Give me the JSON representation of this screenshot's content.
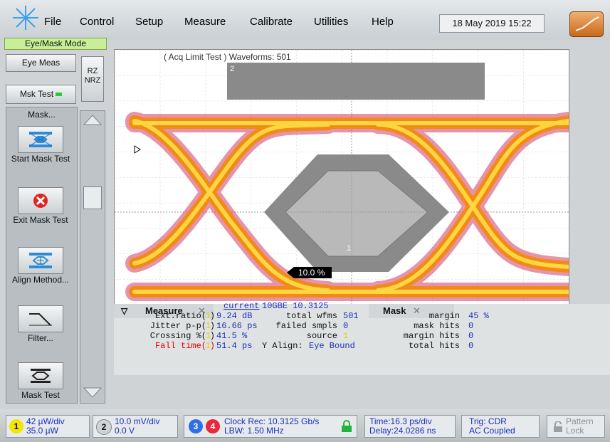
{
  "menu": {
    "file": "File",
    "control": "Control",
    "setup": "Setup",
    "measure": "Measure",
    "calibrate": "Calibrate",
    "utilities": "Utilities",
    "help": "Help"
  },
  "datetime": "18 May 2019   15:22",
  "mode_tab": "Eye/Mask Mode",
  "left": {
    "eye_meas": "Eye Meas",
    "msk_test": "Msk Test",
    "rz": "RZ",
    "nrz": "NRZ",
    "strip_title": "Mask...",
    "tools": [
      "Start Mask Test",
      "Exit Mask Test",
      "Align Method...",
      "Filter...",
      "Mask Test"
    ]
  },
  "screen": {
    "title": "( Acq Limit Test )  Waveforms: 501",
    "marker_2": "2",
    "marker_1": "1",
    "margin_label": "10.0 %"
  },
  "measure_tab": "Measure",
  "mask_tab": "Mask",
  "measure": {
    "current_header": "current",
    "rows": [
      {
        "label": "Ext.ratio(",
        "ch": "1",
        "value": "9.24 dB"
      },
      {
        "label": "Jitter p-p(",
        "ch": "1",
        "value": "16.66 ps"
      },
      {
        "label": "Crossing %(",
        "ch": "1",
        "value": "41.5 %"
      },
      {
        "label": "Fall time(",
        "ch": "1",
        "value": "51.4 ps"
      }
    ]
  },
  "mask": {
    "name": "10GBE 10.3125",
    "total_wfms_label": "total wfms",
    "total_wfms": "501",
    "failed_label": "failed smpls",
    "failed": "0",
    "source_label": "source",
    "source": "1",
    "yalign_label": "Y Align:",
    "yalign": "Eye Bound",
    "margin_label": "margin",
    "margin": "45 %",
    "mask_hits_label": "mask hits",
    "mask_hits": "0",
    "margin_hits_label": "margin hits",
    "margin_hits": "0",
    "total_hits_label": "total hits",
    "total_hits": "0"
  },
  "status": {
    "ch1_num": "1",
    "ch1_scale": "42 µW/div",
    "ch1_offset": "35.0 µW",
    "ch2_num": "2",
    "ch2_scale": "10.0 mV/div",
    "ch2_offset": "0.0 V",
    "ch3_num": "3",
    "ch4_num": "4",
    "clock": "Clock Rec: 10.3125 Gb/s",
    "lbw": "LBW: 1.50 MHz",
    "time": "Time:16.3 ps/div",
    "delay": "Delay:24.0286 ns",
    "trig": "Trig: CDR",
    "coupling": "AC Coupled",
    "pattern": "Pattern",
    "lock": "Lock"
  },
  "colors": {
    "ch1": "#f2e600",
    "ch3": "#2f6fe8",
    "ch4": "#e8283c",
    "mode": "#c8ef98",
    "mask": "#8a8a8a"
  }
}
